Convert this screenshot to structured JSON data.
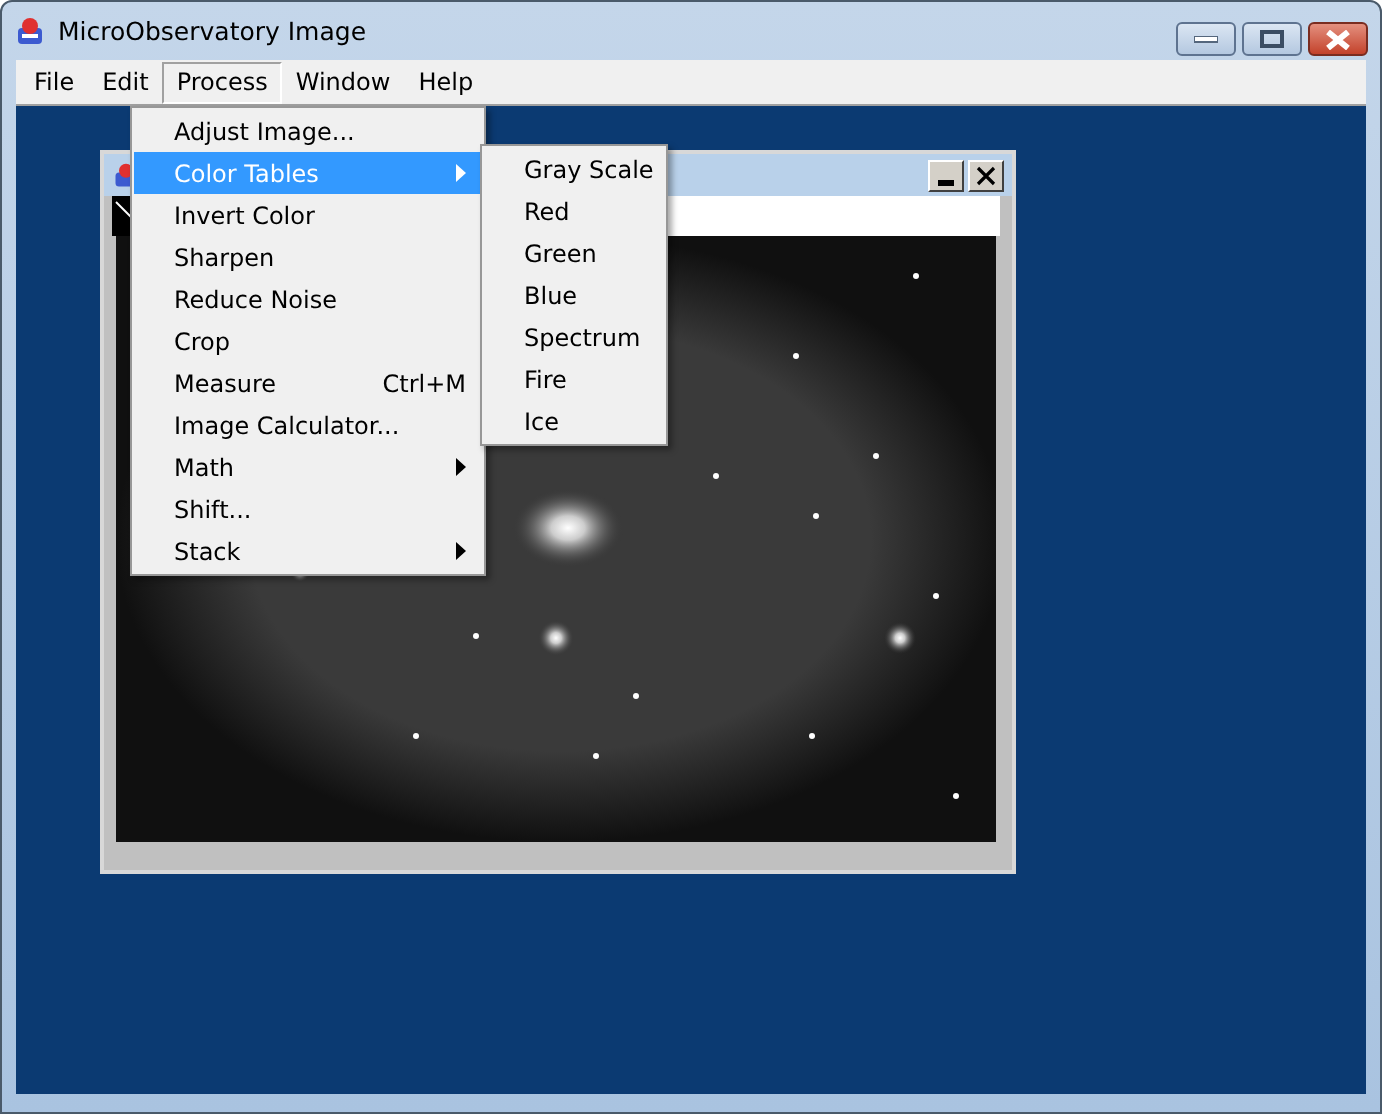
{
  "window": {
    "title": "MicroObservatory Image"
  },
  "menubar": [
    {
      "label": "File",
      "selected": false
    },
    {
      "label": "Edit",
      "selected": false
    },
    {
      "label": "Process",
      "selected": true
    },
    {
      "label": "Window",
      "selected": false
    },
    {
      "label": "Help",
      "selected": false
    }
  ],
  "process_menu": [
    {
      "label": "Adjust Image...",
      "selected": false,
      "submenu": false
    },
    {
      "label": "Color Tables",
      "selected": true,
      "submenu": true
    },
    {
      "label": "Invert Color",
      "selected": false,
      "submenu": false
    },
    {
      "label": "Sharpen",
      "selected": false,
      "submenu": false
    },
    {
      "label": "Reduce Noise",
      "selected": false,
      "submenu": false
    },
    {
      "label": "Crop",
      "selected": false,
      "submenu": false
    },
    {
      "label": "Measure",
      "shortcut": "Ctrl+M",
      "selected": false,
      "submenu": false
    },
    {
      "label": "Image Calculator...",
      "selected": false,
      "submenu": false
    },
    {
      "label": "Math",
      "selected": false,
      "submenu": true
    },
    {
      "label": "Shift...",
      "selected": false,
      "submenu": false
    },
    {
      "label": "Stack",
      "selected": false,
      "submenu": true
    }
  ],
  "color_tables_menu": [
    {
      "label": "Gray Scale"
    },
    {
      "label": "Red"
    },
    {
      "label": "Green"
    },
    {
      "label": "Blue"
    },
    {
      "label": "Spectrum"
    },
    {
      "label": "Fire"
    },
    {
      "label": "Ice"
    }
  ]
}
